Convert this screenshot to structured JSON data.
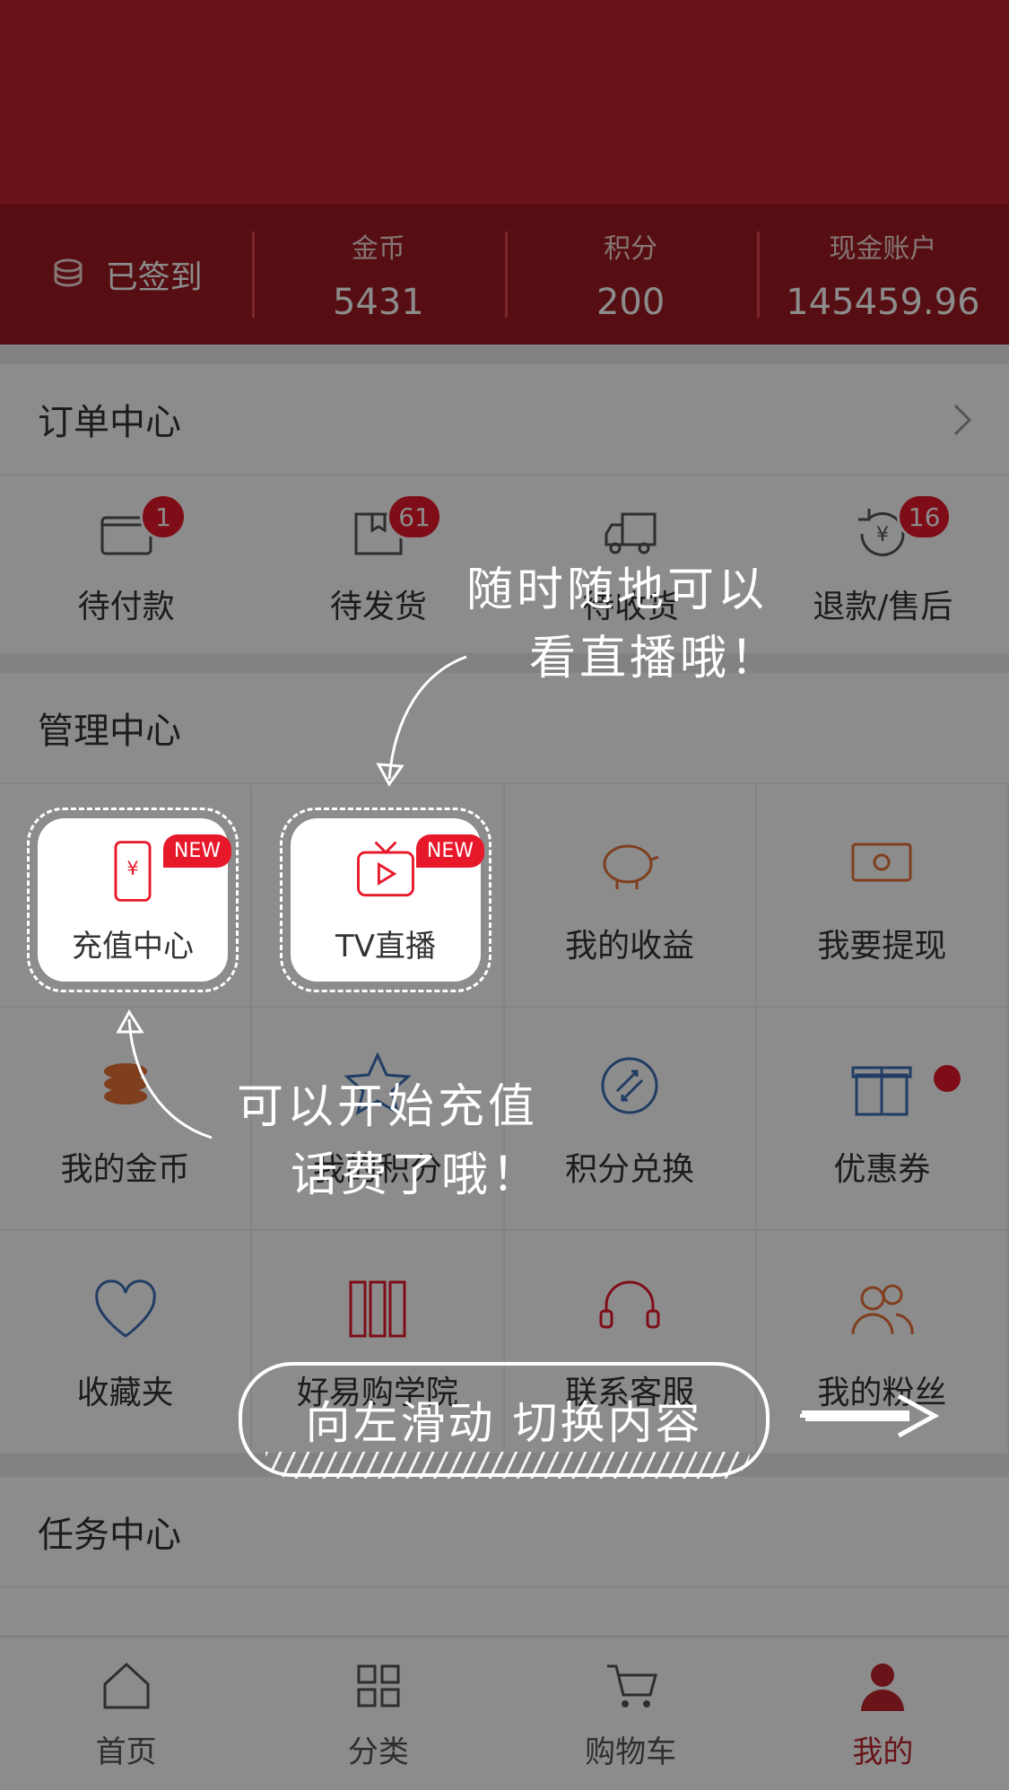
{
  "stats": {
    "signed_label": "已签到",
    "coins": {
      "label": "金币",
      "value": "5431"
    },
    "points": {
      "label": "积分",
      "value": "200"
    },
    "cash": {
      "label": "现金账户",
      "value": "145459.96"
    }
  },
  "orders": {
    "title": "订单中心",
    "items": [
      {
        "label": "待付款",
        "badge": "1",
        "icon": "wallet-icon"
      },
      {
        "label": "待发货",
        "badge": "61",
        "icon": "box-icon"
      },
      {
        "label": "待收货",
        "badge": "",
        "icon": "truck-icon"
      },
      {
        "label": "退款/售后",
        "badge": "16",
        "icon": "refund-icon"
      }
    ]
  },
  "manage": {
    "title": "管理中心",
    "items": [
      {
        "label": "充值中心",
        "icon": "phone-recharge-icon",
        "tag": "NEW"
      },
      {
        "label": "TV直播",
        "icon": "tv-icon",
        "tag": "NEW"
      },
      {
        "label": "我的收益",
        "icon": "piggy-bank-icon"
      },
      {
        "label": "我要提现",
        "icon": "cash-note-icon"
      },
      {
        "label": "我的金币",
        "icon": "coin-stack-icon"
      },
      {
        "label": "我的积分",
        "icon": "star-icon"
      },
      {
        "label": "积分兑换",
        "icon": "exchange-icon"
      },
      {
        "label": "优惠券",
        "icon": "gift-icon",
        "dot": true
      },
      {
        "label": "收藏夹",
        "icon": "heart-icon"
      },
      {
        "label": "好易购学院",
        "icon": "books-icon"
      },
      {
        "label": "联系客服",
        "icon": "headset-icon"
      },
      {
        "label": "我的粉丝",
        "icon": "fans-icon"
      }
    ]
  },
  "tasks": {
    "title": "任务中心"
  },
  "tabbar": [
    {
      "label": "首页",
      "icon": "home-icon"
    },
    {
      "label": "分类",
      "icon": "category-icon"
    },
    {
      "label": "购物车",
      "icon": "cart-icon"
    },
    {
      "label": "我的",
      "icon": "profile-icon",
      "active": true
    }
  ],
  "notes": {
    "tv_line1": "随时随地可以",
    "tv_line2": "看直播哦！",
    "recharge_line1": "可以开始充值",
    "recharge_line2": "话费了哦！",
    "swipe": "向左滑动 切换内容"
  },
  "colors": {
    "brand_red": "#c0252c",
    "badge_red": "#e8182b",
    "icon_orange": "#e8743a",
    "icon_blue": "#3d6fb6"
  }
}
